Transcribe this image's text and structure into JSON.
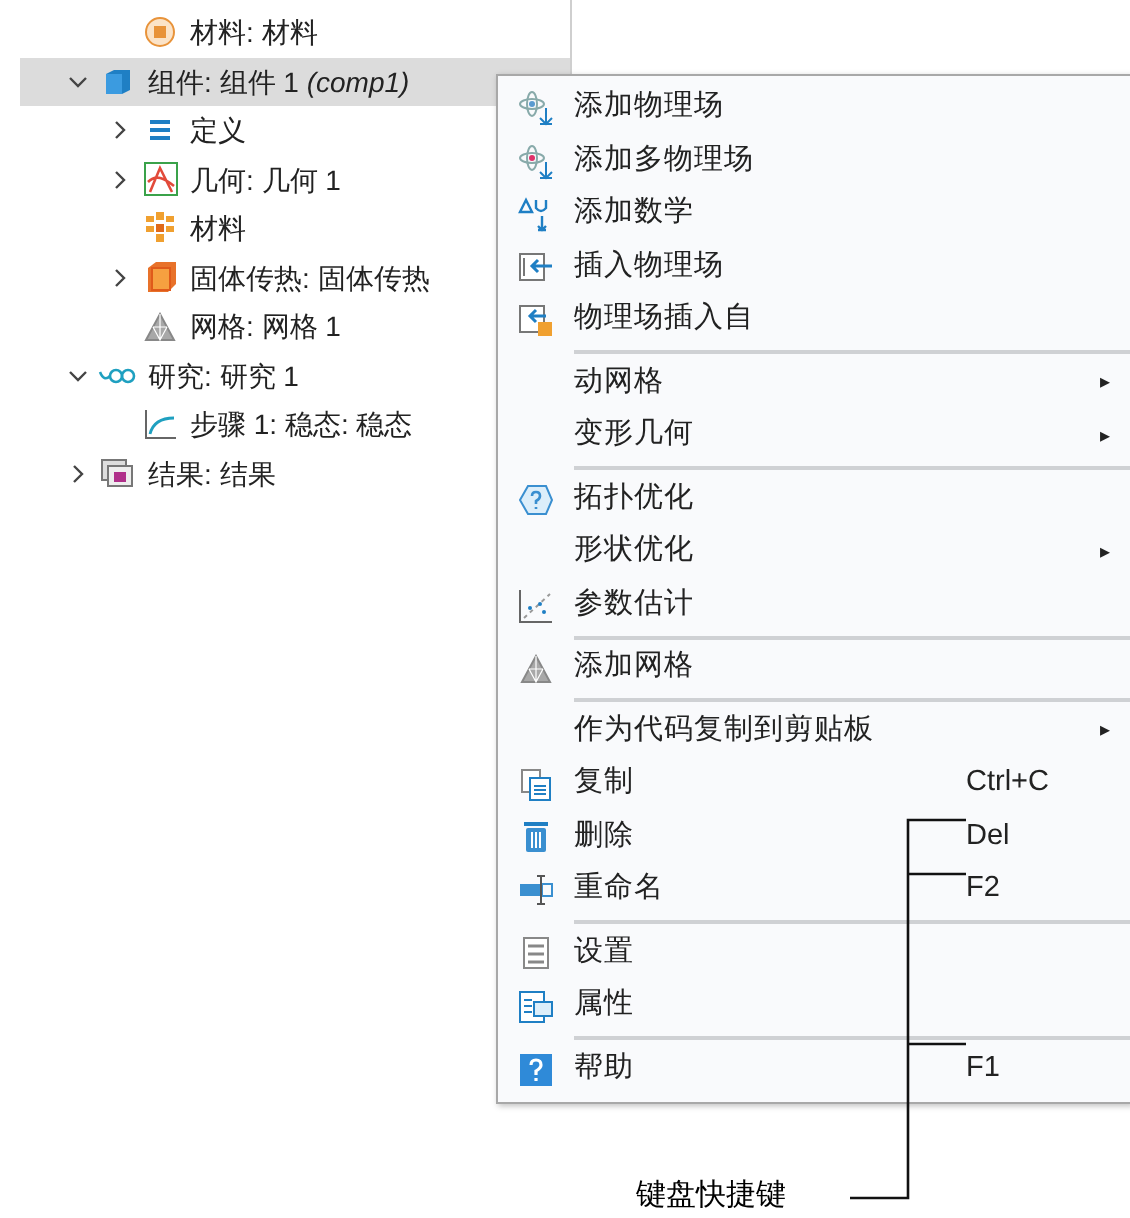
{
  "tree": {
    "continued_items": [
      {
        "label": "材料: 材料",
        "kind": "material-node",
        "selected": false
      }
    ],
    "items": [
      {
        "label": "组件: 组件 1 *(comp1)*",
        "kind": "component",
        "expanded": true,
        "selected": true,
        "children": [
          {
            "label": "定义",
            "kind": "definitions",
            "expanded": false,
            "selected": false
          },
          {
            "label": "几何: 几何 1",
            "kind": "geometry",
            "expanded": false,
            "selected": false
          },
          {
            "label": "材料",
            "kind": "materials",
            "selected": false
          },
          {
            "label": "固体传热: 固体传热",
            "kind": "heat",
            "expanded": false,
            "selected": false
          },
          {
            "label": "网格: 网格 1",
            "kind": "mesh",
            "selected": false
          }
        ]
      },
      {
        "label": "研究: 研究 1",
        "kind": "study",
        "expanded": true,
        "selected": false,
        "children": [
          {
            "label": "步骤 1: 稳态: 稳态",
            "kind": "step",
            "selected": false
          }
        ]
      },
      {
        "label": "结果: 结果",
        "kind": "results",
        "expanded": false,
        "selected": false
      }
    ]
  },
  "context_menu": [
    {
      "kind": "atom",
      "label": "添加物理场"
    },
    {
      "kind": "atom-multi",
      "label": "添加多物理场"
    },
    {
      "kind": "math",
      "label": "添加数学"
    },
    {
      "kind": "insert",
      "label": "插入物理场"
    },
    {
      "kind": "insert-from",
      "label": "物理场插入自"
    },
    {
      "kind": "separator"
    },
    {
      "kind": "submenu",
      "label": "动网格",
      "arrow": "▸"
    },
    {
      "kind": "submenu",
      "label": "变形几何",
      "arrow": "▸"
    },
    {
      "kind": "separator"
    },
    {
      "kind": "topology",
      "label": "拓扑优化"
    },
    {
      "kind": "submenu",
      "label": "形状优化",
      "arrow": "▸"
    },
    {
      "kind": "estimate",
      "label": "参数估计"
    },
    {
      "kind": "separator"
    },
    {
      "kind": "mesh",
      "label": "添加网格"
    },
    {
      "kind": "separator"
    },
    {
      "kind": "submenu",
      "label": "作为代码复制到剪贴板",
      "arrow": "▸"
    },
    {
      "kind": "copy",
      "label": "复制",
      "shortcut": "Ctrl+C"
    },
    {
      "kind": "delete",
      "label": "删除",
      "shortcut": "Del"
    },
    {
      "kind": "rename",
      "label": "重命名",
      "shortcut": "F2"
    },
    {
      "kind": "separator"
    },
    {
      "kind": "settings",
      "label": "设置"
    },
    {
      "kind": "properties",
      "label": "属性"
    },
    {
      "kind": "separator"
    },
    {
      "kind": "help",
      "label": "帮助",
      "shortcut": "F1"
    }
  ],
  "annotation": {
    "label": "键盘快捷键"
  }
}
